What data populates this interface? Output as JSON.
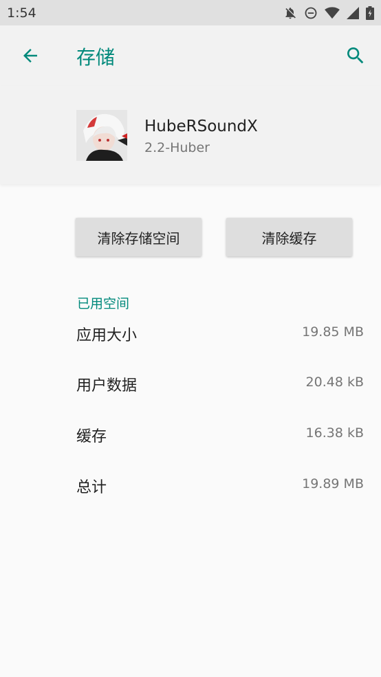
{
  "status_bar": {
    "time": "1:54",
    "icons": [
      "notifications-off-icon",
      "do-not-disturb-icon",
      "wifi-icon",
      "signal-icon",
      "battery-icon"
    ]
  },
  "app_bar": {
    "title": "存储",
    "back_icon": "arrow-back-icon",
    "search_icon": "search-icon"
  },
  "app_info": {
    "name": "HubeRSoundX",
    "version": "2.2-Huber"
  },
  "actions": {
    "clear_storage": "清除存储空间",
    "clear_cache": "清除缓存"
  },
  "used_space": {
    "section_title": "已用空间",
    "rows": [
      {
        "label": "应用大小",
        "value": "19.85 MB"
      },
      {
        "label": "用户数据",
        "value": "20.48 kB"
      },
      {
        "label": "缓存",
        "value": "16.38 kB"
      },
      {
        "label": "总计",
        "value": "19.89 MB"
      }
    ]
  },
  "colors": {
    "accent": "#00897b",
    "status_bar_bg": "#e0e0e0",
    "header_bg": "#f2f2f2",
    "page_bg": "#fafafa"
  }
}
